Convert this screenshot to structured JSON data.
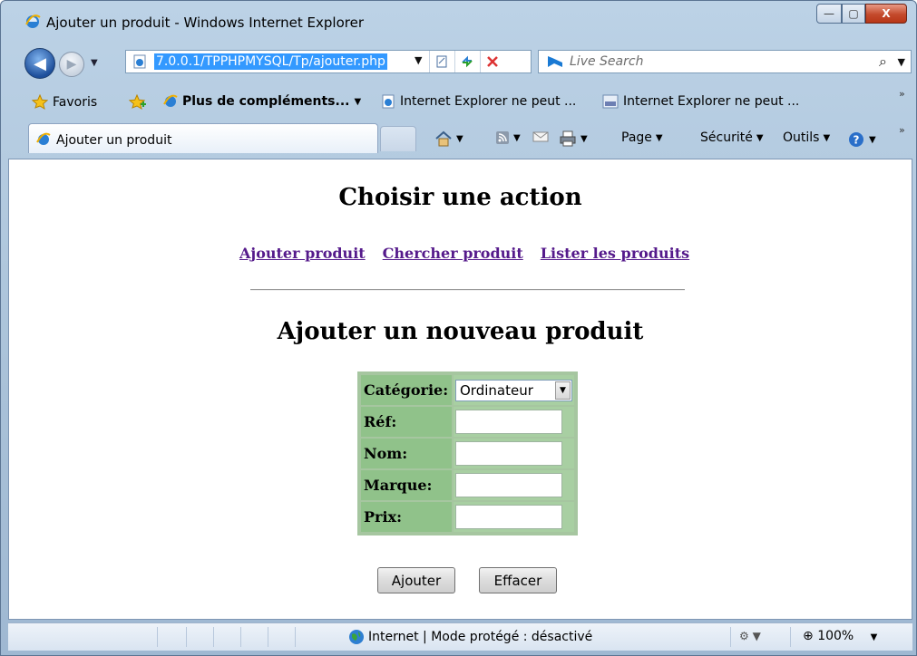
{
  "window": {
    "title": "Ajouter un produit - Windows Internet Explorer",
    "controls": {
      "minimize": "—",
      "maximize": "▢",
      "close": "X"
    }
  },
  "nav": {
    "back": "◀",
    "forward": "▶",
    "history_dropdown": "▼",
    "address_url": "7.0.0.1/TPPHPMYSQL/Tp/ajouter.php",
    "address_dropdown": "▼",
    "search_placeholder": "Live Search",
    "search_go": "⌕",
    "search_dropdown": "▼"
  },
  "favorites_bar": {
    "favoris": "Favoris",
    "more_addons": "Plus de compléments...",
    "link1": "Internet Explorer ne peut ...",
    "link2": "Internet Explorer ne peut ...",
    "overflow": "»"
  },
  "tabs": [
    {
      "label": "Ajouter un produit"
    }
  ],
  "command_bar": {
    "page": "Page",
    "security": "Sécurité",
    "tools": "Outils",
    "overflow": "»"
  },
  "page": {
    "heading": "Choisir une action",
    "links": [
      "Ajouter produit",
      "Chercher produit",
      "Lister les produits"
    ],
    "form_heading": "Ajouter un nouveau produit",
    "form": {
      "category_label": "Catégorie:",
      "category_value": "Ordinateur",
      "ref_label": "Réf:",
      "name_label": "Nom:",
      "brand_label": "Marque:",
      "price_label": "Prix:",
      "ref_value": "",
      "name_value": "",
      "brand_value": "",
      "price_value": ""
    },
    "submit_label": "Ajouter",
    "reset_label": "Effacer"
  },
  "status_bar": {
    "zone": "Internet | Mode protégé : désactivé",
    "zoom": "100%"
  },
  "colors": {
    "link_visited": "#551a8b",
    "form_green": "#90c28a",
    "url_highlight": "#3399ff"
  }
}
